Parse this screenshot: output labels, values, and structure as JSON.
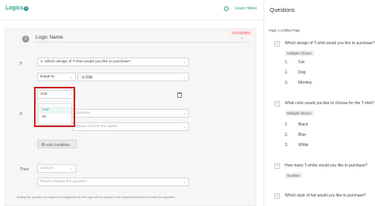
{
  "logics_panel": {
    "title": "Logics",
    "learn_more": "Learn More",
    "status_badge": "Incomplete",
    "logic_number": "1",
    "logic_name": "Logic Name",
    "if_label": "If",
    "if_question": "1. Which design of T-shirt would you like to purchase?",
    "operator": "Equal to",
    "value_chip": "1. Cat",
    "connector_selected": "And",
    "connector_options": [
      "And",
      "Or"
    ],
    "if2_question": "Question",
    "if2_option_placeholder": "Please choose the option",
    "add_condition": "Add Condition",
    "then_label": "Then",
    "jump_to": "Jump to",
    "jump_target_placeholder": "Please choose the question",
    "note": "Setting the question as required is suggested as this logic will be skipped if the respondent doesn't answer the question."
  },
  "questions_panel": {
    "title": "Questions",
    "page_label": "Page 1 Untitled Page",
    "questions": [
      {
        "number": "1",
        "text": "Which design of T-shirt would you like to purchase?",
        "type": "Multiple Choice",
        "options": [
          {
            "num": "1.",
            "label": "Cat"
          },
          {
            "num": "2.",
            "label": "Dog"
          },
          {
            "num": "3.",
            "label": "Monkey"
          }
        ]
      },
      {
        "number": "2",
        "text": "What color would you like to choose for the T-shirt?",
        "type": "Multiple Choice",
        "options": [
          {
            "num": "1.",
            "label": "Black"
          },
          {
            "num": "2.",
            "label": "Blue"
          },
          {
            "num": "3.",
            "label": "White"
          }
        ]
      },
      {
        "number": "3",
        "text": "How many T-shirts would you like to purchase?",
        "type": "Number",
        "options": []
      },
      {
        "number": "4",
        "text": "Which style of hat would you like to purchase?",
        "type": "",
        "options": []
      }
    ]
  },
  "colors": {
    "accent": "#2b9e8f",
    "highlight_outline": "#cc2222",
    "incomplete": "#e05a5a"
  }
}
